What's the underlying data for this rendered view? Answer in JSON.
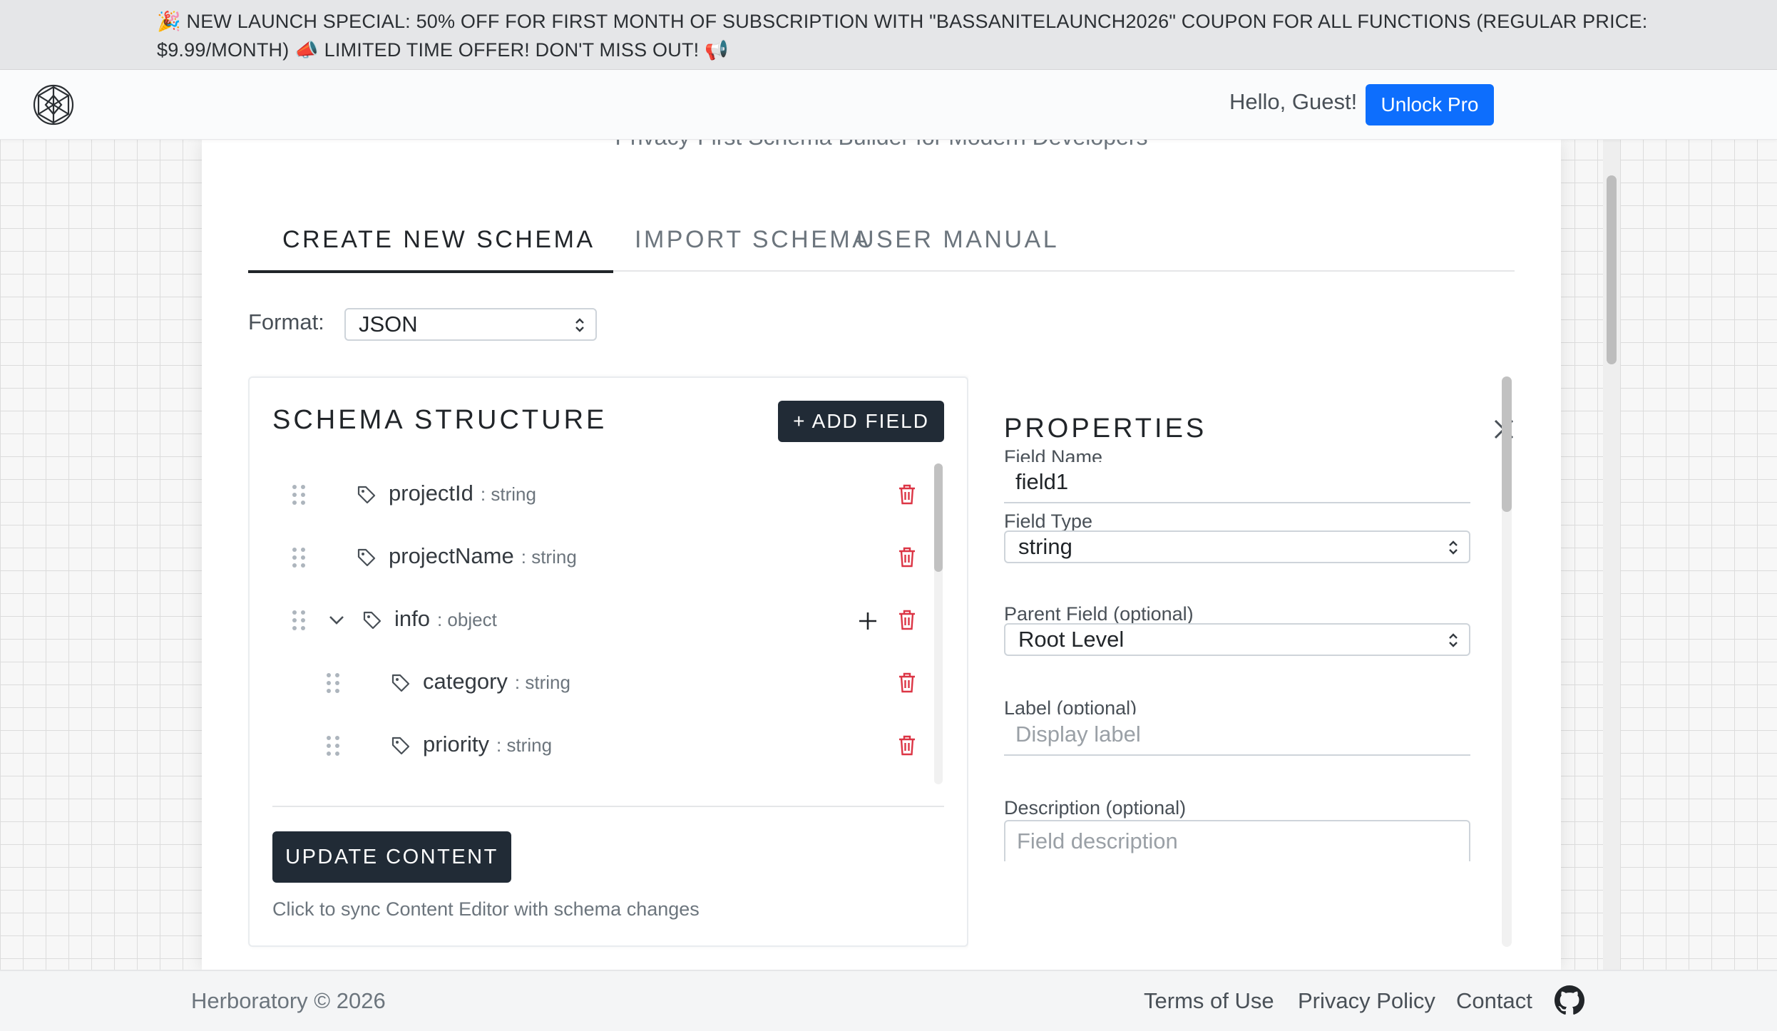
{
  "promo": {
    "line1": "🎉 NEW LAUNCH SPECIAL: 50% OFF FOR FIRST MONTH OF SUBSCRIPTION WITH \"BASSANITELAUNCH2026\" COUPON FOR ALL FUNCTIONS   (REGULAR PRICE:",
    "line2": "$9.99/MONTH) 📣 LIMITED TIME OFFER! DON'T MISS OUT! 📢"
  },
  "navbar": {
    "logo_icon": "crystal-logo-icon",
    "greeting": "Hello, Guest!",
    "unlock_label": "Unlock Pro",
    "accent": "#0d6efd"
  },
  "header": {
    "subtitle": "Privacy-First Schema Builder for Modern Developers"
  },
  "tabs": [
    {
      "label": "CREATE NEW SCHEMA",
      "active": true
    },
    {
      "label": "IMPORT SCHEMA",
      "active": false
    },
    {
      "label": "USER MANUAL",
      "active": false
    }
  ],
  "format": {
    "label": "Format:",
    "value": "JSON"
  },
  "schema": {
    "title": "SCHEMA STRUCTURE",
    "add_field_label": "+ ADD FIELD",
    "fields": [
      {
        "name": "projectId",
        "type": ": string",
        "depth": 0,
        "expandable": false
      },
      {
        "name": "projectName",
        "type": ": string",
        "depth": 0,
        "expandable": false
      },
      {
        "name": "info",
        "type": ": object",
        "depth": 0,
        "expandable": true
      },
      {
        "name": "category",
        "type": ": string",
        "depth": 1,
        "expandable": false
      },
      {
        "name": "priority",
        "type": ": string",
        "depth": 1,
        "expandable": false
      }
    ],
    "update_label": "UPDATE CONTENT",
    "update_hint": "Click to sync Content Editor with schema changes",
    "delete_color": "#dc3545"
  },
  "properties": {
    "title": "PROPERTIES",
    "field_name_label": "Field Name",
    "field_name_value": "field1",
    "field_type_label": "Field Type",
    "field_type_value": "string",
    "parent_label": "Parent Field (optional)",
    "parent_value": "Root Level",
    "display_label": "Label (optional)",
    "display_placeholder": "Display label",
    "description_label": "Description (optional)",
    "description_placeholder": "Field description"
  },
  "footer": {
    "copyright": "Herboratory © 2026",
    "terms": "Terms of Use",
    "privacy": "Privacy Policy",
    "contact": "Contact",
    "github_icon": "github-icon"
  }
}
